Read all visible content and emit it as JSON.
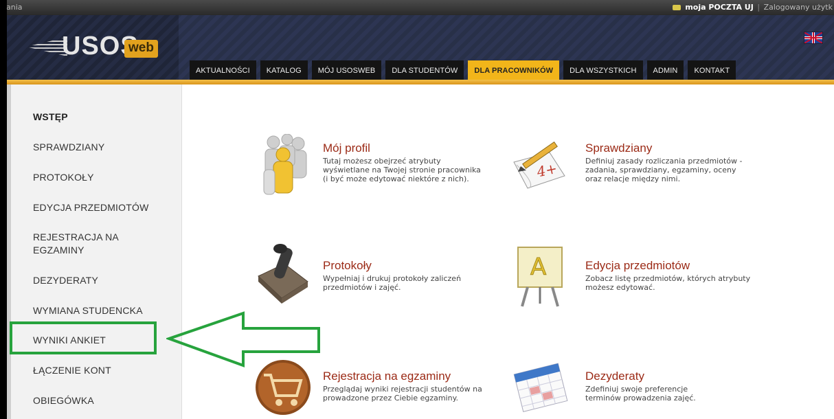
{
  "topbar": {
    "left_text": "wania",
    "mail_label": "moja POCZTA UJ",
    "separator": "|",
    "logged_text": "Zalogowany użytk"
  },
  "logo": {
    "main": "USOS",
    "badge": "web"
  },
  "nav": {
    "tabs": [
      {
        "label": "AKTUALNOŚCI",
        "active": false
      },
      {
        "label": "KATALOG",
        "active": false
      },
      {
        "label": "MÓJ USOSWEB",
        "active": false
      },
      {
        "label": "DLA STUDENTÓW",
        "active": false
      },
      {
        "label": "DLA PRACOWNIKÓW",
        "active": true
      },
      {
        "label": "DLA WSZYSTKICH",
        "active": false
      },
      {
        "label": "ADMIN",
        "active": false
      },
      {
        "label": "KONTAKT",
        "active": false
      }
    ]
  },
  "sidebar": {
    "items": [
      {
        "label": "WSTĘP"
      },
      {
        "label": "SPRAWDZIANY"
      },
      {
        "label": "PROTOKOŁY"
      },
      {
        "label": "EDYCJA PRZEDMIOTÓW"
      },
      {
        "label": "REJESTRACJA NA\nEGZAMINY"
      },
      {
        "label": "DEZYDERATY"
      },
      {
        "label": "WYMIANA STUDENCKA"
      },
      {
        "label": "WYNIKI ANKIET"
      },
      {
        "label": "ŁĄCZENIE KONT"
      },
      {
        "label": "OBIEGÓWKA"
      }
    ]
  },
  "cards": [
    {
      "title": "Mój profil",
      "desc": "Tutaj możesz obejrzeć atrybuty\nwyświetlane na Twojej stronie pracownika\n(i być może edytować niektóre z nich).",
      "icon": "people-icon"
    },
    {
      "title": "Sprawdziany",
      "desc": "Definiuj zasady rozliczania przedmiotów -\nzadania, sprawdziany, egzaminy, oceny\noraz relacje między nimi.",
      "icon": "grade-pencil-icon"
    },
    {
      "title": "Protokoły",
      "desc": "Wypełniaj i drukuj protokoły zaliczeń\nprzedmiotów i zajęć.",
      "icon": "stamp-icon"
    },
    {
      "title": "Edycja przedmiotów",
      "desc": "Zobacz listę przedmiotów, których atrybuty\nmożesz edytować.",
      "icon": "easel-icon"
    },
    {
      "title": "Rejestracja na egzaminy",
      "desc": "Przeglądaj wyniki rejestracji studentów na\nprowadzone przez Ciebie egzaminy.",
      "icon": "cart-icon"
    },
    {
      "title": "Dezyderaty",
      "desc": "Zdefiniuj swoje preferencje\nterminów prowadzenia zajęć.",
      "icon": "calendar-icon"
    }
  ],
  "annotation": {
    "color": "#27a33d"
  },
  "colors": {
    "accent": "#f2b51a",
    "title_red": "#9b2a16",
    "header_dark": "#2d3553"
  }
}
